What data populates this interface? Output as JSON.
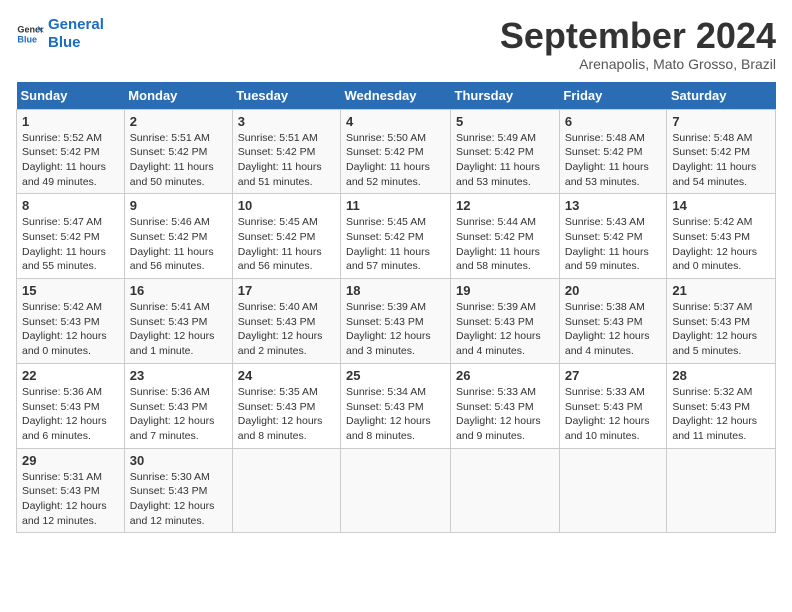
{
  "logo": {
    "line1": "General",
    "line2": "Blue"
  },
  "title": "September 2024",
  "subtitle": "Arenapolis, Mato Grosso, Brazil",
  "days_of_week": [
    "Sunday",
    "Monday",
    "Tuesday",
    "Wednesday",
    "Thursday",
    "Friday",
    "Saturday"
  ],
  "weeks": [
    [
      {
        "day": "1",
        "sunrise": "5:52 AM",
        "sunset": "5:42 PM",
        "daylight": "11 hours and 49 minutes."
      },
      {
        "day": "2",
        "sunrise": "5:51 AM",
        "sunset": "5:42 PM",
        "daylight": "11 hours and 50 minutes."
      },
      {
        "day": "3",
        "sunrise": "5:51 AM",
        "sunset": "5:42 PM",
        "daylight": "11 hours and 51 minutes."
      },
      {
        "day": "4",
        "sunrise": "5:50 AM",
        "sunset": "5:42 PM",
        "daylight": "11 hours and 52 minutes."
      },
      {
        "day": "5",
        "sunrise": "5:49 AM",
        "sunset": "5:42 PM",
        "daylight": "11 hours and 53 minutes."
      },
      {
        "day": "6",
        "sunrise": "5:48 AM",
        "sunset": "5:42 PM",
        "daylight": "11 hours and 53 minutes."
      },
      {
        "day": "7",
        "sunrise": "5:48 AM",
        "sunset": "5:42 PM",
        "daylight": "11 hours and 54 minutes."
      }
    ],
    [
      {
        "day": "8",
        "sunrise": "5:47 AM",
        "sunset": "5:42 PM",
        "daylight": "11 hours and 55 minutes."
      },
      {
        "day": "9",
        "sunrise": "5:46 AM",
        "sunset": "5:42 PM",
        "daylight": "11 hours and 56 minutes."
      },
      {
        "day": "10",
        "sunrise": "5:45 AM",
        "sunset": "5:42 PM",
        "daylight": "11 hours and 56 minutes."
      },
      {
        "day": "11",
        "sunrise": "5:45 AM",
        "sunset": "5:42 PM",
        "daylight": "11 hours and 57 minutes."
      },
      {
        "day": "12",
        "sunrise": "5:44 AM",
        "sunset": "5:42 PM",
        "daylight": "11 hours and 58 minutes."
      },
      {
        "day": "13",
        "sunrise": "5:43 AM",
        "sunset": "5:42 PM",
        "daylight": "11 hours and 59 minutes."
      },
      {
        "day": "14",
        "sunrise": "5:42 AM",
        "sunset": "5:43 PM",
        "daylight": "12 hours and 0 minutes."
      }
    ],
    [
      {
        "day": "15",
        "sunrise": "5:42 AM",
        "sunset": "5:43 PM",
        "daylight": "12 hours and 0 minutes."
      },
      {
        "day": "16",
        "sunrise": "5:41 AM",
        "sunset": "5:43 PM",
        "daylight": "12 hours and 1 minute."
      },
      {
        "day": "17",
        "sunrise": "5:40 AM",
        "sunset": "5:43 PM",
        "daylight": "12 hours and 2 minutes."
      },
      {
        "day": "18",
        "sunrise": "5:39 AM",
        "sunset": "5:43 PM",
        "daylight": "12 hours and 3 minutes."
      },
      {
        "day": "19",
        "sunrise": "5:39 AM",
        "sunset": "5:43 PM",
        "daylight": "12 hours and 4 minutes."
      },
      {
        "day": "20",
        "sunrise": "5:38 AM",
        "sunset": "5:43 PM",
        "daylight": "12 hours and 4 minutes."
      },
      {
        "day": "21",
        "sunrise": "5:37 AM",
        "sunset": "5:43 PM",
        "daylight": "12 hours and 5 minutes."
      }
    ],
    [
      {
        "day": "22",
        "sunrise": "5:36 AM",
        "sunset": "5:43 PM",
        "daylight": "12 hours and 6 minutes."
      },
      {
        "day": "23",
        "sunrise": "5:36 AM",
        "sunset": "5:43 PM",
        "daylight": "12 hours and 7 minutes."
      },
      {
        "day": "24",
        "sunrise": "5:35 AM",
        "sunset": "5:43 PM",
        "daylight": "12 hours and 8 minutes."
      },
      {
        "day": "25",
        "sunrise": "5:34 AM",
        "sunset": "5:43 PM",
        "daylight": "12 hours and 8 minutes."
      },
      {
        "day": "26",
        "sunrise": "5:33 AM",
        "sunset": "5:43 PM",
        "daylight": "12 hours and 9 minutes."
      },
      {
        "day": "27",
        "sunrise": "5:33 AM",
        "sunset": "5:43 PM",
        "daylight": "12 hours and 10 minutes."
      },
      {
        "day": "28",
        "sunrise": "5:32 AM",
        "sunset": "5:43 PM",
        "daylight": "12 hours and 11 minutes."
      }
    ],
    [
      {
        "day": "29",
        "sunrise": "5:31 AM",
        "sunset": "5:43 PM",
        "daylight": "12 hours and 12 minutes."
      },
      {
        "day": "30",
        "sunrise": "5:30 AM",
        "sunset": "5:43 PM",
        "daylight": "12 hours and 12 minutes."
      },
      null,
      null,
      null,
      null,
      null
    ]
  ]
}
